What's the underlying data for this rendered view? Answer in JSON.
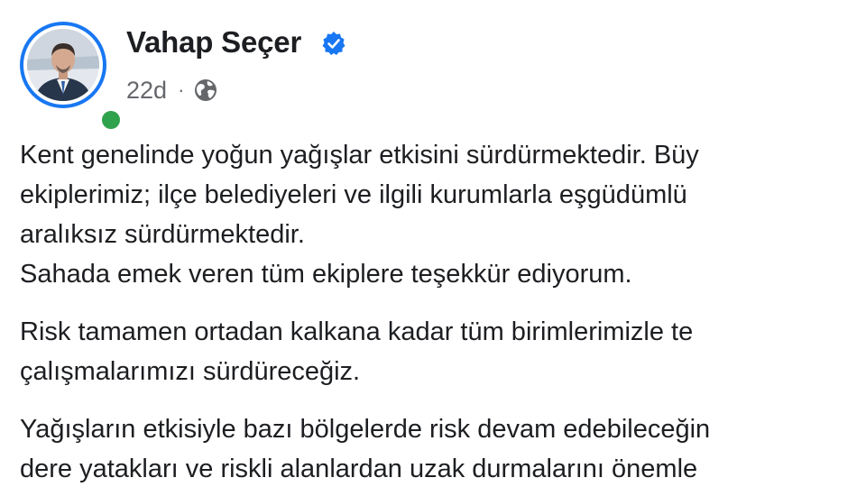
{
  "post": {
    "author": "Vahap Seçer",
    "verified_icon": "verified-badge-icon",
    "time": "22d",
    "separator": "·",
    "audience_icon": "globe-icon",
    "paragraphs": [
      [
        "Kent genelinde yoğun yağışlar etkisini sürdürmektedir. Büy",
        "ekiplerimiz; ilçe belediyeleri ve ilgili kurumlarla eşgüdümlü",
        "aralıksız sürdürmektedir.",
        "Sahada emek veren tüm ekiplere teşekkür ediyorum."
      ],
      [
        "Risk tamamen ortadan kalkana kadar tüm birimlerimizle te",
        "çalışmalarımızı sürdüreceğiz."
      ],
      [
        "Yağışların etkisiyle bazı bölgelerde risk devam edebileceğin",
        "dere yatakları ve riskli alanlardan uzak durmalarını önemle"
      ]
    ]
  },
  "colors": {
    "accent": "#1877f2",
    "online": "#31a24c",
    "text": "#1c1e21",
    "secondary_text": "#65676b"
  }
}
